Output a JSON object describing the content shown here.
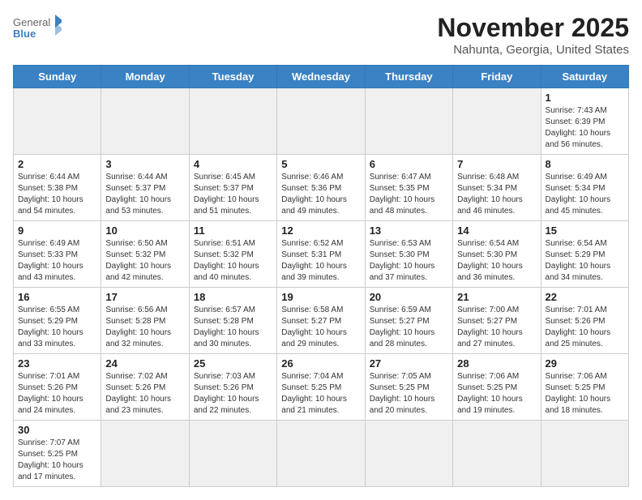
{
  "logo": {
    "text_general": "General",
    "text_blue": "Blue"
  },
  "title": "November 2025",
  "location": "Nahunta, Georgia, United States",
  "days_of_week": [
    "Sunday",
    "Monday",
    "Tuesday",
    "Wednesday",
    "Thursday",
    "Friday",
    "Saturday"
  ],
  "weeks": [
    [
      {
        "day": null,
        "info": null
      },
      {
        "day": null,
        "info": null
      },
      {
        "day": null,
        "info": null
      },
      {
        "day": null,
        "info": null
      },
      {
        "day": null,
        "info": null
      },
      {
        "day": null,
        "info": null
      },
      {
        "day": "1",
        "info": "Sunrise: 7:43 AM\nSunset: 6:39 PM\nDaylight: 10 hours and 56 minutes."
      }
    ],
    [
      {
        "day": "2",
        "info": "Sunrise: 6:44 AM\nSunset: 5:38 PM\nDaylight: 10 hours and 54 minutes."
      },
      {
        "day": "3",
        "info": "Sunrise: 6:44 AM\nSunset: 5:37 PM\nDaylight: 10 hours and 53 minutes."
      },
      {
        "day": "4",
        "info": "Sunrise: 6:45 AM\nSunset: 5:37 PM\nDaylight: 10 hours and 51 minutes."
      },
      {
        "day": "5",
        "info": "Sunrise: 6:46 AM\nSunset: 5:36 PM\nDaylight: 10 hours and 49 minutes."
      },
      {
        "day": "6",
        "info": "Sunrise: 6:47 AM\nSunset: 5:35 PM\nDaylight: 10 hours and 48 minutes."
      },
      {
        "day": "7",
        "info": "Sunrise: 6:48 AM\nSunset: 5:34 PM\nDaylight: 10 hours and 46 minutes."
      },
      {
        "day": "8",
        "info": "Sunrise: 6:49 AM\nSunset: 5:34 PM\nDaylight: 10 hours and 45 minutes."
      }
    ],
    [
      {
        "day": "9",
        "info": "Sunrise: 6:49 AM\nSunset: 5:33 PM\nDaylight: 10 hours and 43 minutes."
      },
      {
        "day": "10",
        "info": "Sunrise: 6:50 AM\nSunset: 5:32 PM\nDaylight: 10 hours and 42 minutes."
      },
      {
        "day": "11",
        "info": "Sunrise: 6:51 AM\nSunset: 5:32 PM\nDaylight: 10 hours and 40 minutes."
      },
      {
        "day": "12",
        "info": "Sunrise: 6:52 AM\nSunset: 5:31 PM\nDaylight: 10 hours and 39 minutes."
      },
      {
        "day": "13",
        "info": "Sunrise: 6:53 AM\nSunset: 5:30 PM\nDaylight: 10 hours and 37 minutes."
      },
      {
        "day": "14",
        "info": "Sunrise: 6:54 AM\nSunset: 5:30 PM\nDaylight: 10 hours and 36 minutes."
      },
      {
        "day": "15",
        "info": "Sunrise: 6:54 AM\nSunset: 5:29 PM\nDaylight: 10 hours and 34 minutes."
      }
    ],
    [
      {
        "day": "16",
        "info": "Sunrise: 6:55 AM\nSunset: 5:29 PM\nDaylight: 10 hours and 33 minutes."
      },
      {
        "day": "17",
        "info": "Sunrise: 6:56 AM\nSunset: 5:28 PM\nDaylight: 10 hours and 32 minutes."
      },
      {
        "day": "18",
        "info": "Sunrise: 6:57 AM\nSunset: 5:28 PM\nDaylight: 10 hours and 30 minutes."
      },
      {
        "day": "19",
        "info": "Sunrise: 6:58 AM\nSunset: 5:27 PM\nDaylight: 10 hours and 29 minutes."
      },
      {
        "day": "20",
        "info": "Sunrise: 6:59 AM\nSunset: 5:27 PM\nDaylight: 10 hours and 28 minutes."
      },
      {
        "day": "21",
        "info": "Sunrise: 7:00 AM\nSunset: 5:27 PM\nDaylight: 10 hours and 27 minutes."
      },
      {
        "day": "22",
        "info": "Sunrise: 7:01 AM\nSunset: 5:26 PM\nDaylight: 10 hours and 25 minutes."
      }
    ],
    [
      {
        "day": "23",
        "info": "Sunrise: 7:01 AM\nSunset: 5:26 PM\nDaylight: 10 hours and 24 minutes."
      },
      {
        "day": "24",
        "info": "Sunrise: 7:02 AM\nSunset: 5:26 PM\nDaylight: 10 hours and 23 minutes."
      },
      {
        "day": "25",
        "info": "Sunrise: 7:03 AM\nSunset: 5:26 PM\nDaylight: 10 hours and 22 minutes."
      },
      {
        "day": "26",
        "info": "Sunrise: 7:04 AM\nSunset: 5:25 PM\nDaylight: 10 hours and 21 minutes."
      },
      {
        "day": "27",
        "info": "Sunrise: 7:05 AM\nSunset: 5:25 PM\nDaylight: 10 hours and 20 minutes."
      },
      {
        "day": "28",
        "info": "Sunrise: 7:06 AM\nSunset: 5:25 PM\nDaylight: 10 hours and 19 minutes."
      },
      {
        "day": "29",
        "info": "Sunrise: 7:06 AM\nSunset: 5:25 PM\nDaylight: 10 hours and 18 minutes."
      }
    ],
    [
      {
        "day": "30",
        "info": "Sunrise: 7:07 AM\nSunset: 5:25 PM\nDaylight: 10 hours and 17 minutes."
      },
      {
        "day": null,
        "info": null
      },
      {
        "day": null,
        "info": null
      },
      {
        "day": null,
        "info": null
      },
      {
        "day": null,
        "info": null
      },
      {
        "day": null,
        "info": null
      },
      {
        "day": null,
        "info": null
      }
    ]
  ]
}
